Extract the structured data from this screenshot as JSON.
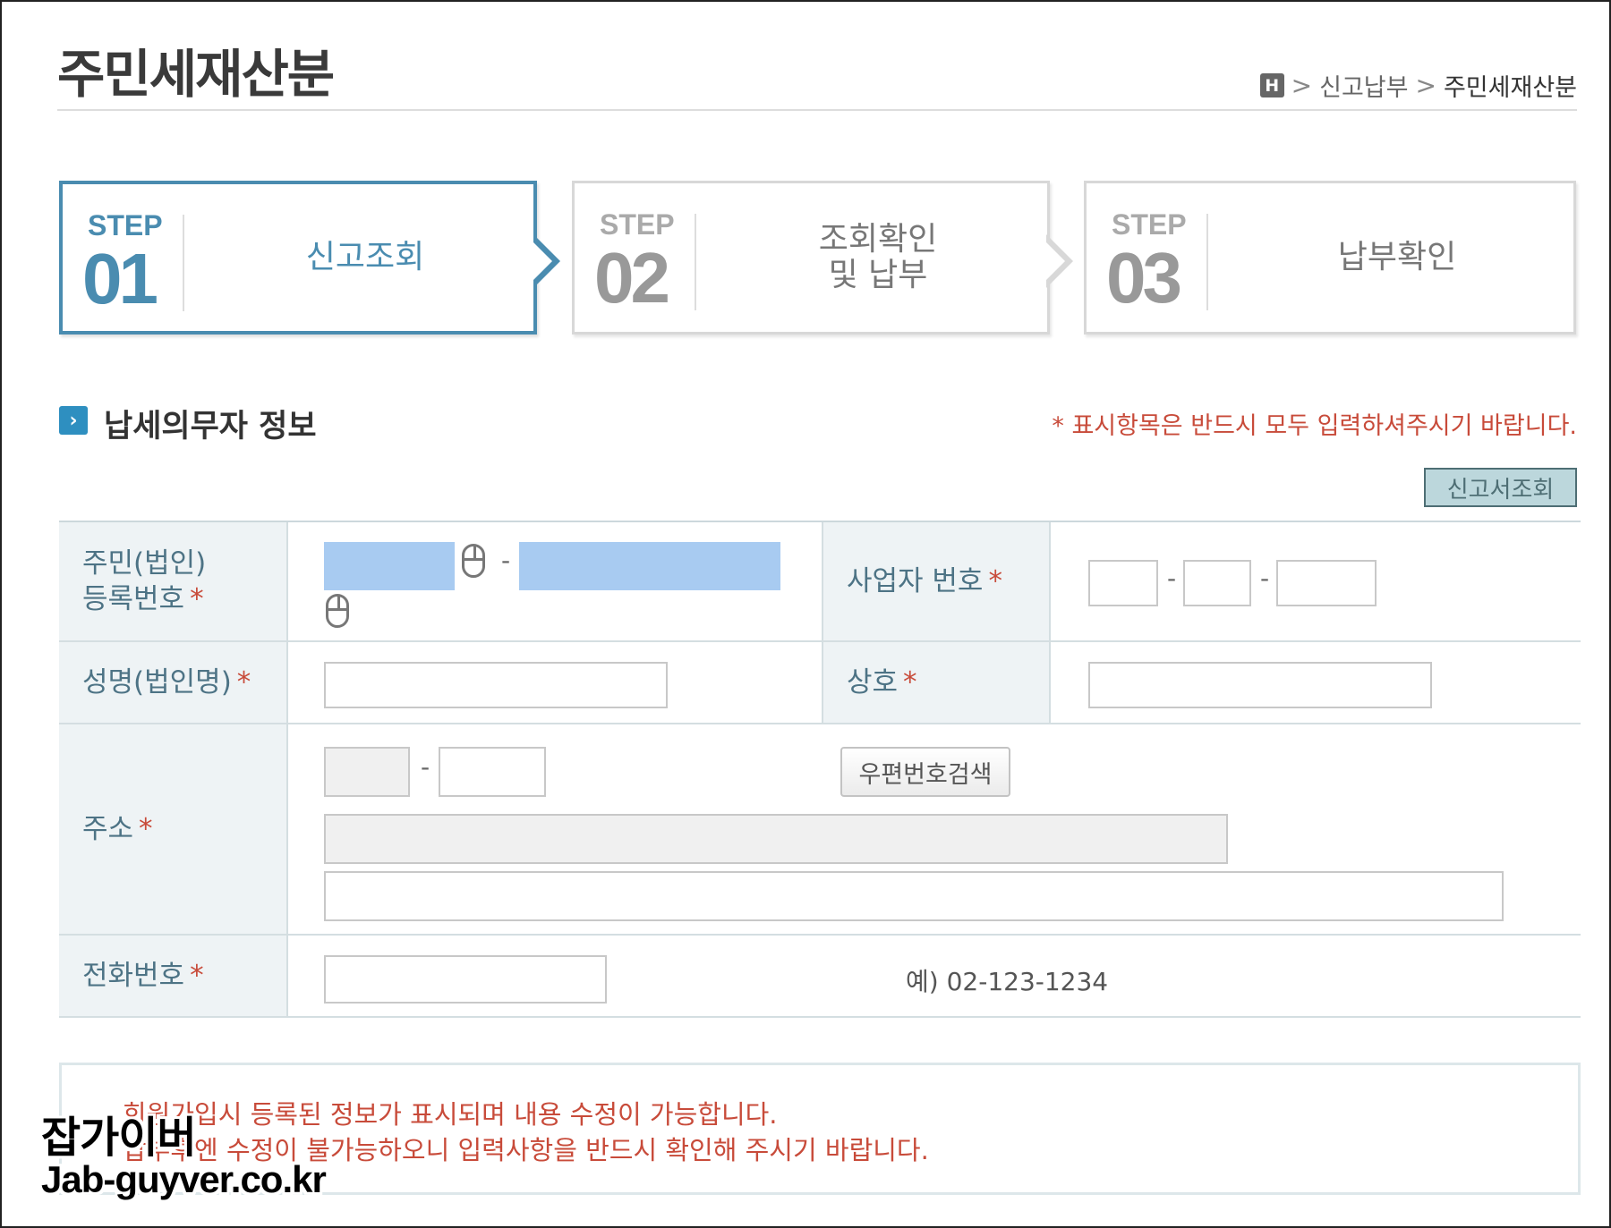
{
  "header": {
    "title": "주민세재산분",
    "breadcrumb": {
      "home_icon": "H",
      "separator": ">",
      "items": [
        "신고납부",
        "주민세재산분"
      ]
    }
  },
  "steps": [
    {
      "word": "STEP",
      "number": "01",
      "label": "신고조회",
      "active": true
    },
    {
      "word": "STEP",
      "number": "02",
      "label": "조회확인\n및 납부",
      "active": false
    },
    {
      "word": "STEP",
      "number": "03",
      "label": "납부확인",
      "active": false
    }
  ],
  "section": {
    "icon": "chevron-right-icon",
    "title": "납세의무자 정보",
    "required_note": "* 표시항목은 반드시 모두 입력하셔주시기 바랍니다.",
    "lookup_button": "신고서조회"
  },
  "form": {
    "resident_number": {
      "label": "주민(법인)\n등록번호",
      "required": "*"
    },
    "business_number": {
      "label": "사업자 번호",
      "required": "*"
    },
    "name": {
      "label": "성명(법인명)",
      "required": "*"
    },
    "company": {
      "label": "상호",
      "required": "*"
    },
    "address": {
      "label": "주소",
      "required": "*",
      "zip_search_button": "우편번호검색"
    },
    "phone": {
      "label": "전화번호",
      "required": "*",
      "example": "예) 02-123-1234"
    },
    "dash": "-"
  },
  "notice": {
    "line1": "회원가입시 등록된 정보가 표시되며 내용 수정이 가능합니다.",
    "line2": "납부후엔 수정이 불가능하오니 입력사항을 반드시 확인해 주시기 바랍니다."
  },
  "watermark": {
    "name": "잡가이버",
    "url": "Jab-guyver.co.kr"
  },
  "colors": {
    "accent": "#4a8cb0",
    "required_red": "#c84b3a",
    "header_cell_bg": "#eef3f5",
    "masked_blue": "#a8cbf1",
    "lookup_btn_bg": "#bcd7dc"
  }
}
